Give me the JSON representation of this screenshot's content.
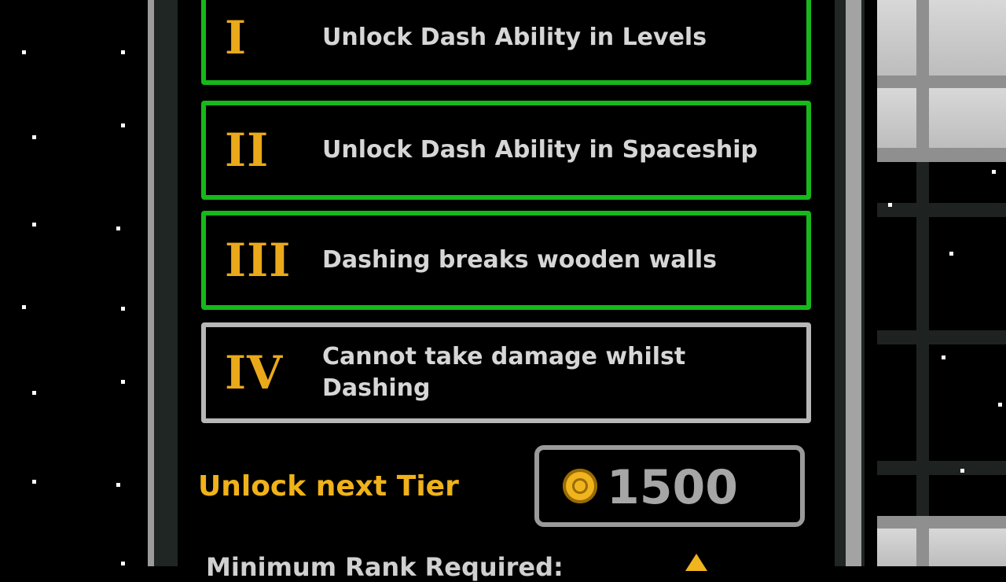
{
  "tiers": [
    {
      "numeral": "I",
      "description": "Unlock Dash Ability in Levels",
      "status": "unlocked"
    },
    {
      "numeral": "II",
      "description": "Unlock Dash Ability in Spaceship",
      "status": "unlocked"
    },
    {
      "numeral": "III",
      "description": "Dashing breaks wooden walls",
      "status": "unlocked"
    },
    {
      "numeral": "IV",
      "description": "Cannot take damage whilst Dashing",
      "status": "locked"
    }
  ],
  "unlock": {
    "label": "Unlock next Tier",
    "cost": "1500",
    "currency_icon": "coin-icon"
  },
  "footer": {
    "partial_text": "Minimum Rank Required:"
  },
  "colors": {
    "unlocked_border": "#17b81a",
    "locked_border": "#b7b7b7",
    "numeral": "#eaa91a",
    "accent_text": "#efb21a"
  }
}
